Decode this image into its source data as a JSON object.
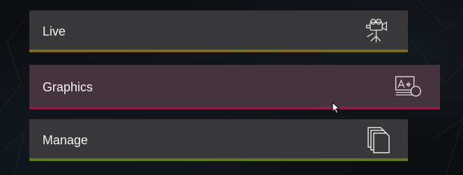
{
  "menu": {
    "items": [
      {
        "label": "Live",
        "icon": "video-camera-icon",
        "accent": "#7a6a22"
      },
      {
        "label": "Graphics",
        "icon": "graphics-title-icon",
        "accent": "#8a1d44"
      },
      {
        "label": "Manage",
        "icon": "stacked-pages-icon",
        "accent": "#5d7a1f"
      }
    ]
  },
  "colors": {
    "background": "#0c0e11",
    "item_bg": "#38383a",
    "item_active_bg": "#45343d",
    "text": "#f2f2f2"
  }
}
